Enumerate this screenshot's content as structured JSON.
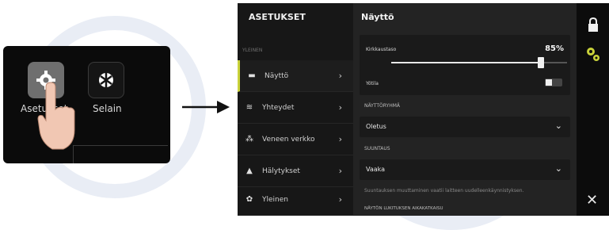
{
  "inset": {
    "apps": [
      {
        "label": "Asetukset",
        "icon": "gear-icon"
      },
      {
        "label": "Selain",
        "icon": "globe-icon"
      }
    ]
  },
  "settings": {
    "header": "ASETUKSET",
    "section_label": "YLEINEN",
    "nav": [
      {
        "label": "Näyttö",
        "icon": "monitor-icon",
        "active": true
      },
      {
        "label": "Yhteydet",
        "icon": "wifi-icon"
      },
      {
        "label": "Veneen verkko",
        "icon": "network-icon"
      },
      {
        "label": "Hälytykset",
        "icon": "warning-icon"
      },
      {
        "label": "Yleinen",
        "icon": "gear-icon"
      }
    ],
    "chevron": "›"
  },
  "display": {
    "title": "Näyttö",
    "brightness_label": "Kirkkaustaso",
    "brightness_value": "85%",
    "brightness_fraction": 0.85,
    "night_label": "Yötila",
    "display_group_label": "NÄYTTÖRYHMÄ",
    "display_group_value": "Oletus",
    "orientation_label": "SUUNTAUS",
    "orientation_value": "Vaaka",
    "orientation_note": "Suuntauksen muuttaminen vaatii laitteen uudelleenkäynnistyksen.",
    "lock_group_label": "NÄYTÖN LUKITUKSEN AIKAKATKAISU"
  },
  "colors": {
    "accent": "#c9d23a",
    "panel_bg": "#232323",
    "nav_bg": "#171717",
    "rail_bg": "#0c0c0c"
  }
}
